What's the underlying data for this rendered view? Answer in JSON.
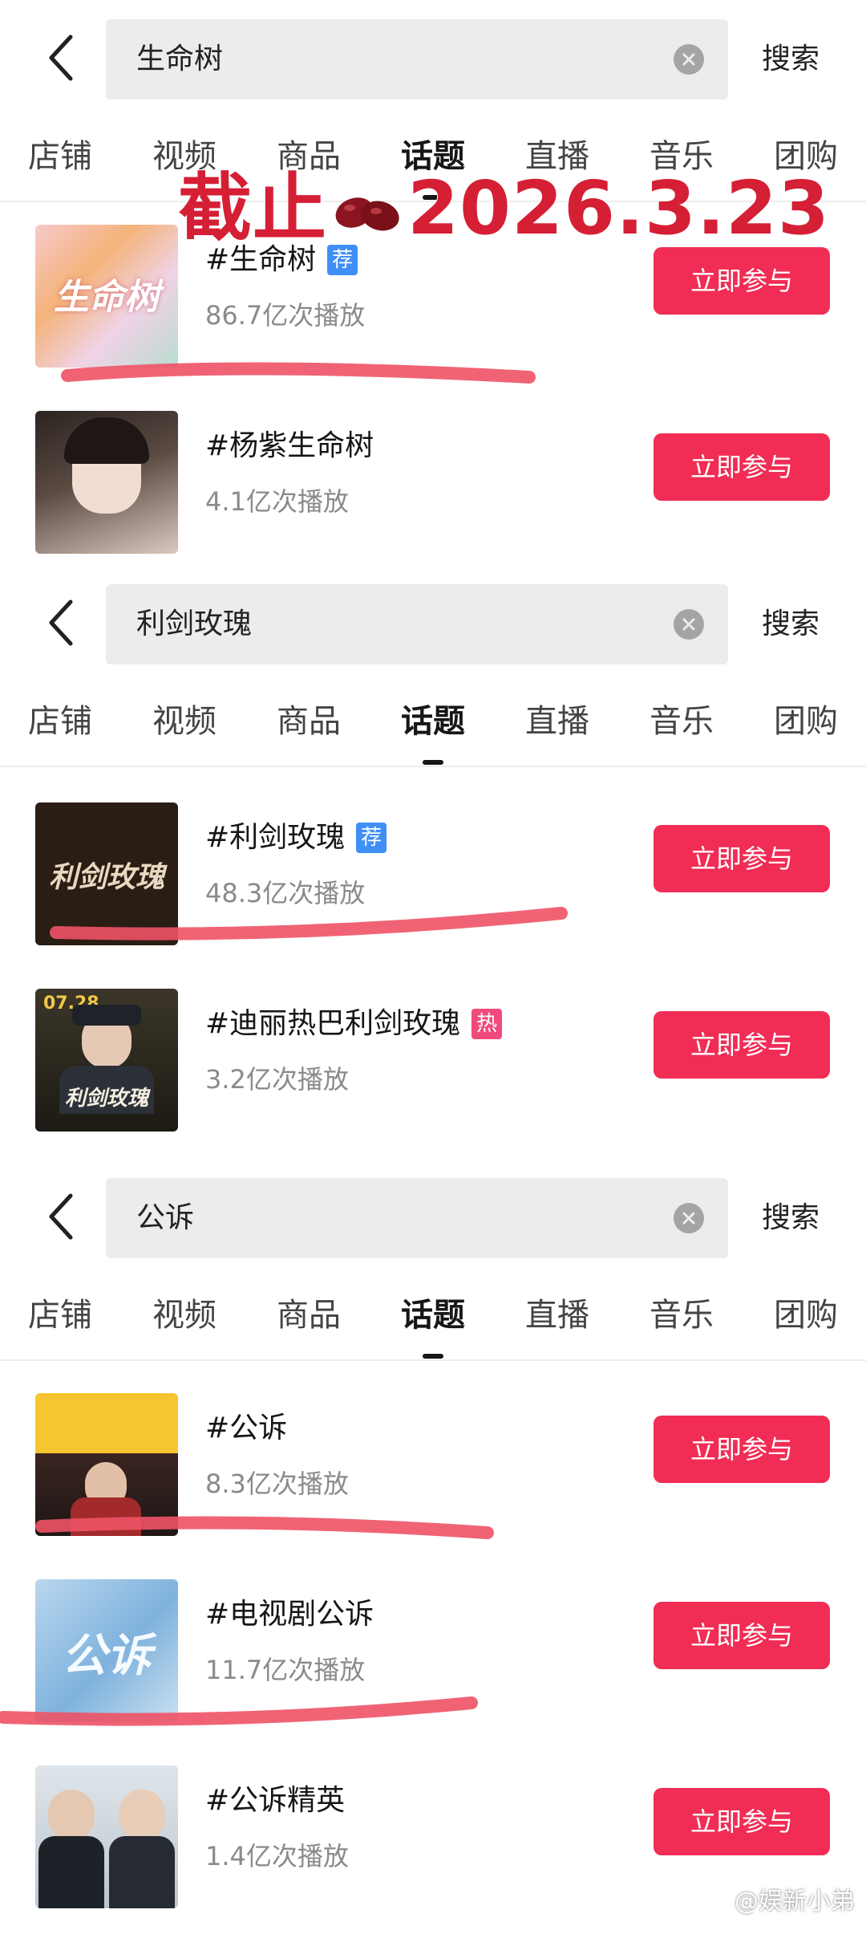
{
  "colors": {
    "accent": "#f12d55",
    "recommend_badge": "#3f8ff7",
    "hot_badge": "#f04a7c",
    "annotation": "#d51f35",
    "highlight_stroke": "#ee5266"
  },
  "overlay": {
    "prefix": "截止",
    "date": "2026.3.23"
  },
  "watermark": "@娱新小弟",
  "sections": [
    {
      "query": "生命树",
      "search_button": "搜索",
      "tabs": [
        "店铺",
        "视频",
        "商品",
        "话题",
        "直播",
        "音乐",
        "团购"
      ],
      "active_tab": "话题",
      "results": [
        {
          "title": "#生命树",
          "badge": "荐",
          "badge_type": "recommend",
          "plays": "86.7亿次播放",
          "action": "立即参与",
          "thumb_text": "生命树"
        },
        {
          "title": "#杨紫生命树",
          "badge": "",
          "badge_type": "",
          "plays": "4.1亿次播放",
          "action": "立即参与",
          "thumb_text": ""
        }
      ]
    },
    {
      "query": "利剑玫瑰",
      "search_button": "搜索",
      "tabs": [
        "店铺",
        "视频",
        "商品",
        "话题",
        "直播",
        "音乐",
        "团购"
      ],
      "active_tab": "话题",
      "results": [
        {
          "title": "#利剑玫瑰",
          "badge": "荐",
          "badge_type": "recommend",
          "plays": "48.3亿次播放",
          "action": "立即参与",
          "thumb_text": "利剑玫瑰"
        },
        {
          "title": "#迪丽热巴利剑玫瑰",
          "badge": "热",
          "badge_type": "hot",
          "plays": "3.2亿次播放",
          "action": "立即参与",
          "thumb_text": "利剑玫瑰",
          "thumb_date": "07.28"
        }
      ]
    },
    {
      "query": "公诉",
      "search_button": "搜索",
      "tabs": [
        "店铺",
        "视频",
        "商品",
        "话题",
        "直播",
        "音乐",
        "团购"
      ],
      "active_tab": "话题",
      "results": [
        {
          "title": "#公诉",
          "badge": "",
          "badge_type": "",
          "plays": "8.3亿次播放",
          "action": "立即参与",
          "thumb_text": ""
        },
        {
          "title": "#电视剧公诉",
          "badge": "",
          "badge_type": "",
          "plays": "11.7亿次播放",
          "action": "立即参与",
          "thumb_text": "公诉"
        },
        {
          "title": "#公诉精英",
          "badge": "",
          "badge_type": "",
          "plays": "1.4亿次播放",
          "action": "立即参与",
          "thumb_text": ""
        }
      ]
    }
  ]
}
